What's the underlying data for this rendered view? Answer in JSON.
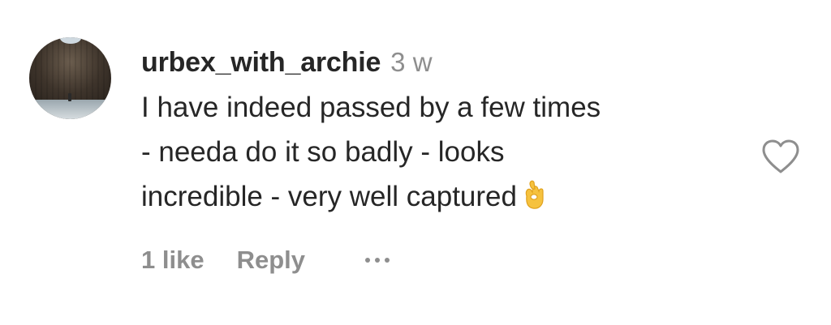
{
  "comment": {
    "username": "urbex_with_archie",
    "timestamp": "3 w",
    "text_lines": [
      "I have indeed passed by a few times",
      "- needa do it so badly - looks",
      "incredible - very well captured"
    ],
    "emoji": "ok-hand-emoji",
    "likes_label": "1 like",
    "reply_label": "Reply",
    "more_icon": "more-options-icon",
    "like_icon": "heart-outline-icon"
  },
  "colors": {
    "text": "#262626",
    "secondary": "#8e8e8e",
    "emoji": "#f6c23e"
  }
}
